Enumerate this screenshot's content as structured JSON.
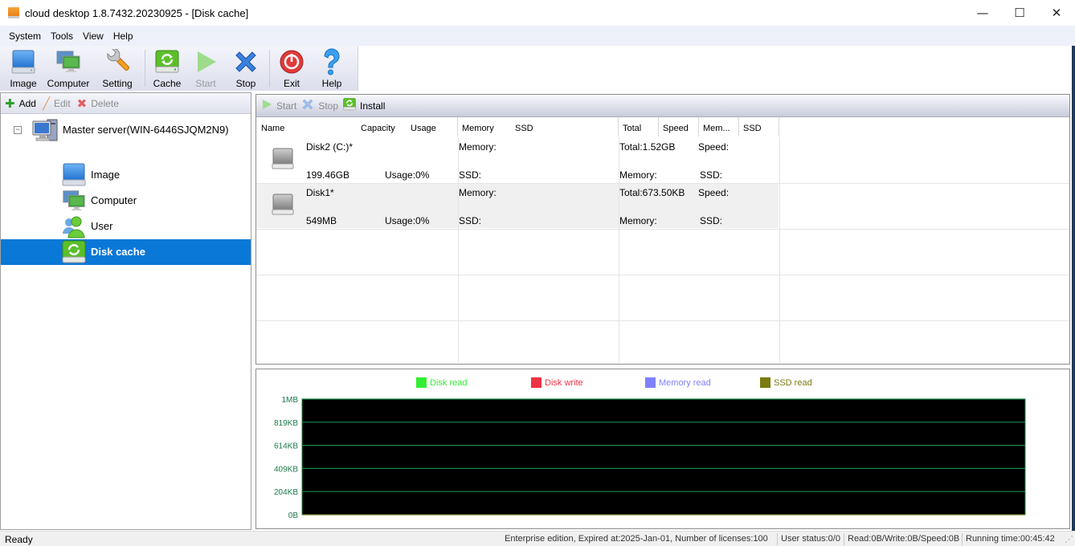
{
  "window": {
    "title": "cloud desktop 1.8.7432.20230925  - [Disk cache]",
    "controls": {
      "minimize": "—",
      "maximize": "☐",
      "close": "✕"
    }
  },
  "menubar": [
    "System",
    "Tools",
    "View",
    "Help"
  ],
  "toolbar": {
    "groups": [
      [
        {
          "label": "Image",
          "icon": "image-disk-icon",
          "enabled": true
        },
        {
          "label": "Computer",
          "icon": "computer-icon",
          "enabled": true
        },
        {
          "label": "Setting",
          "icon": "wrench-icon",
          "enabled": true
        }
      ],
      [
        {
          "label": "Cache",
          "icon": "cache-refresh-icon",
          "enabled": true
        },
        {
          "label": "Start",
          "icon": "play-icon",
          "enabled": false
        },
        {
          "label": "Stop",
          "icon": "stop-x-icon",
          "enabled": true
        }
      ],
      [
        {
          "label": "Exit",
          "icon": "power-icon",
          "enabled": true
        },
        {
          "label": "Help",
          "icon": "question-icon",
          "enabled": true
        }
      ]
    ]
  },
  "left_panel": {
    "actions": [
      {
        "label": "Add",
        "icon": "plus-icon",
        "enabled": true
      },
      {
        "label": "Edit",
        "icon": "pencil-icon",
        "enabled": false
      },
      {
        "label": "Delete",
        "icon": "delete-x-icon",
        "enabled": false
      }
    ],
    "tree": {
      "root": {
        "label": "Master server(WIN-6446SJQM2N9)",
        "expanded": true,
        "expander": "−"
      },
      "children": [
        {
          "label": "Image",
          "icon": "image-disk-icon",
          "selected": false
        },
        {
          "label": "Computer",
          "icon": "computer-icon",
          "selected": false
        },
        {
          "label": "User",
          "icon": "users-icon",
          "selected": false
        },
        {
          "label": "Disk cache",
          "icon": "cache-refresh-icon",
          "selected": true
        }
      ]
    }
  },
  "disk_panel": {
    "actions": [
      {
        "label": "Start",
        "icon": "play-icon",
        "enabled": false
      },
      {
        "label": "Stop",
        "icon": "stop-x-icon",
        "enabled": false
      },
      {
        "label": "Install",
        "icon": "install-icon",
        "enabled": true
      }
    ],
    "columns": [
      "Name",
      "Capacity",
      "Usage",
      "Memory",
      "SSD",
      "Total",
      "Speed",
      "Mem...",
      "SSD"
    ],
    "rows": [
      {
        "name": "Disk2 (C:)*",
        "capacity": "199.46GB",
        "usage": "Usage:0%",
        "memory": "Memory:",
        "ssd": "SSD:",
        "total": "Total:1.52GB",
        "speed": "Speed:",
        "mem2": "Memory:",
        "ssd2": "SSD:"
      },
      {
        "name": "Disk1*",
        "capacity": "549MB",
        "usage": "Usage:0%",
        "memory": "Memory:",
        "ssd": "SSD:",
        "total": "Total:673.50KB",
        "speed": "Speed:",
        "mem2": "Memory:",
        "ssd2": "SSD:"
      }
    ]
  },
  "chart_data": {
    "type": "line",
    "title": "",
    "xlabel": "",
    "ylabel": "",
    "yticks": [
      "0B",
      "204KB",
      "409KB",
      "614KB",
      "819KB",
      "1MB"
    ],
    "ylim": [
      0,
      1048576
    ],
    "grid": true,
    "legend_position": "top-center",
    "background": "#000000",
    "grid_color": "#1a8a4a",
    "series": [
      {
        "name": "Disk read",
        "color": "#33ee33",
        "values": [
          0,
          0
        ]
      },
      {
        "name": "Disk write",
        "color": "#ee3344",
        "values": [
          0,
          0
        ]
      },
      {
        "name": "Memory read",
        "color": "#8080ff",
        "values": [
          0,
          0
        ]
      },
      {
        "name": "SSD read",
        "color": "#7a7a10",
        "values": [
          0,
          0
        ]
      }
    ]
  },
  "statusbar": {
    "status": "Ready",
    "edition": "Enterprise edition, Expired at:2025-Jan-01, Number of licenses:100",
    "user_status": "User status:0/0",
    "io": "Read:0B/Write:0B/Speed:0B",
    "running_time": "Running time:00:45:42"
  }
}
